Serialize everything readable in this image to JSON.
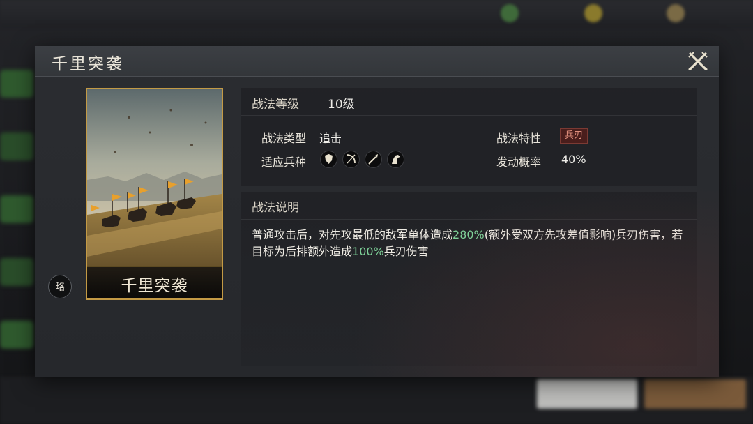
{
  "modal": {
    "title": "千里突袭",
    "close_icon": "crossed-swords-close-icon"
  },
  "card": {
    "name": "千里突袭",
    "brief_label": "略"
  },
  "stats": {
    "level_label": "战法等级",
    "level_value": "10级",
    "type_label": "战法类型",
    "type_value": "追击",
    "trait_label": "战法特性",
    "trait_value": "兵刃",
    "units_label": "适应兵种",
    "units": [
      "shield-icon",
      "bow-icon",
      "spear-icon",
      "horse-icon"
    ],
    "rate_label": "发动概率",
    "rate_value": "40%"
  },
  "description": {
    "heading": "战法说明",
    "part1": "普通攻击后，对先攻最低的敌军单体造成",
    "value1": "280%",
    "part2": "(额外受双方先攻差值影响)兵刃伤害，若目标为后排额外造成",
    "value2": "100%",
    "part3": "兵刃伤害"
  },
  "colors": {
    "accent_gold": "#c39a45",
    "highlight_green": "#7fd39a",
    "trait_red": "#e08f7d"
  }
}
